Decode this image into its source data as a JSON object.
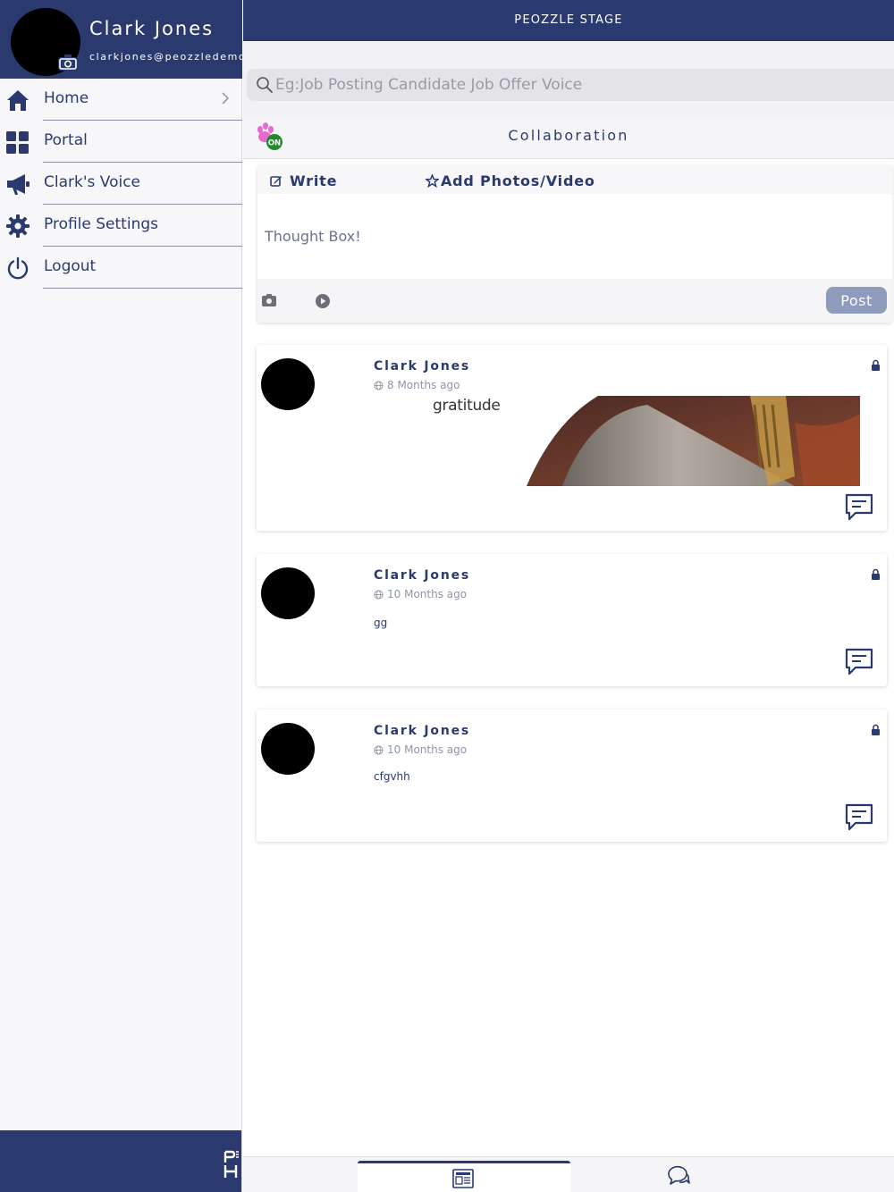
{
  "user": {
    "name": "Clark Jones",
    "email": "clarkjones@peozzledemo"
  },
  "sidebar": {
    "items": [
      {
        "label": "Home",
        "icon": "home-icon"
      },
      {
        "label": "Portal",
        "icon": "grid-icon"
      },
      {
        "label": "Clark's Voice",
        "icon": "megaphone-icon"
      },
      {
        "label": "Profile Settings",
        "icon": "gear-icon"
      },
      {
        "label": "Logout",
        "icon": "power-icon"
      }
    ]
  },
  "header": {
    "title": "PEOZZLE STAGE"
  },
  "search": {
    "placeholder": "Eg:Job Posting Candidate Job Offer Voice"
  },
  "collaboration": {
    "title": "Collaboration",
    "toggle_label": "ON"
  },
  "composer": {
    "write_label": "Write",
    "photos_label": "Add Photos/Video",
    "placeholder": "Thought Box!",
    "post_label": "Post"
  },
  "posts": [
    {
      "author": "Clark Jones",
      "time": "8 Months ago",
      "caption": "gratitude",
      "text": ""
    },
    {
      "author": "Clark Jones",
      "time": "10 Months ago",
      "caption": "",
      "text": "gg"
    },
    {
      "author": "Clark Jones",
      "time": "10 Months ago",
      "caption": "",
      "text": "cfgvhh"
    }
  ],
  "colors": {
    "brand": "#2b3a6e",
    "post_button": "#8f9bbc",
    "toggle_on": "#1f8a2e"
  }
}
